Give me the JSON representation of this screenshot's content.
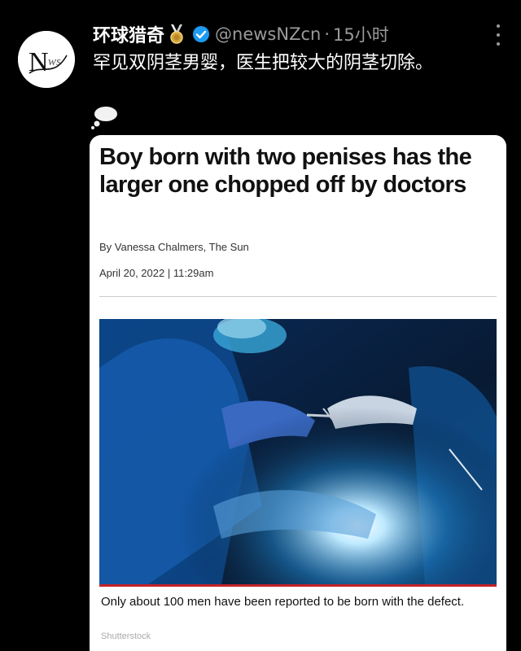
{
  "tweet": {
    "display_name": "环球猎奇",
    "handle": "@newsNZcn",
    "separator": "·",
    "time": "15小时",
    "text": "罕见双阴茎男婴，医生把较大的阴茎切除。",
    "avatar_letters": "N",
    "avatar_sub": "ws",
    "icons": {
      "badge": "medal-icon",
      "verified": "verified-icon",
      "more": "more-vertical-icon",
      "reaction": "thought-bubble-icon"
    }
  },
  "article": {
    "headline": "Boy born with two penises has the larger one chopped off by doctors",
    "byline": "By Vanessa Chalmers, The Sun",
    "dateline": "April 20, 2022 | 11:29am",
    "caption": "Only about 100 men have been reported to be born with the defect.",
    "photo_credit": "Shutterstock"
  },
  "colors": {
    "background": "#000000",
    "verified": "#1d9bf0",
    "accent_bar": "#c4222a"
  }
}
